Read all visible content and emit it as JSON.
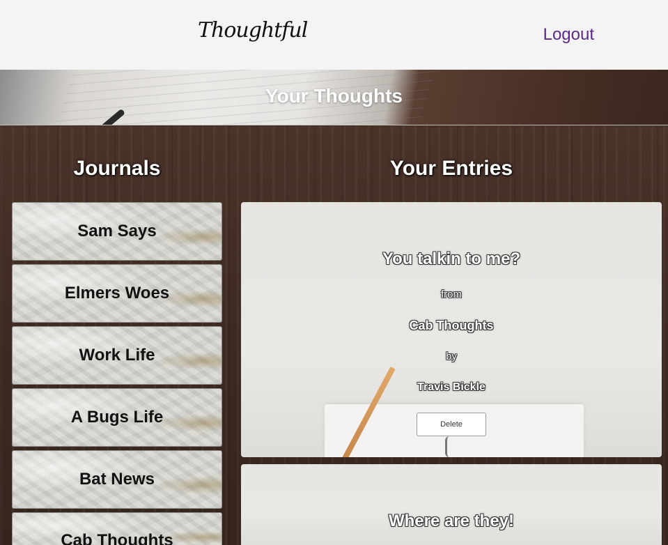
{
  "nav": {
    "logo": "Thoughtful",
    "logout_label": "Logout"
  },
  "banner": {
    "title": "Your Thoughts"
  },
  "journals": {
    "title": "Journals",
    "items": [
      {
        "label": "Sam Says"
      },
      {
        "label": "Elmers Woes"
      },
      {
        "label": "Work Life"
      },
      {
        "label": "A Bugs Life"
      },
      {
        "label": "Bat News"
      },
      {
        "label": "Cab Thoughts"
      }
    ]
  },
  "entries": {
    "title": "Your Entries",
    "items": [
      {
        "title": "You talkin to me?",
        "from_label": "from",
        "journal": "Cab Thoughts",
        "by_label": "by",
        "author": "Travis Bickle",
        "delete_label": "Delete"
      },
      {
        "title": "Where are they!"
      }
    ]
  },
  "colors": {
    "logout": "#5b2a86",
    "navbar_bg": "#f4f4f4"
  }
}
